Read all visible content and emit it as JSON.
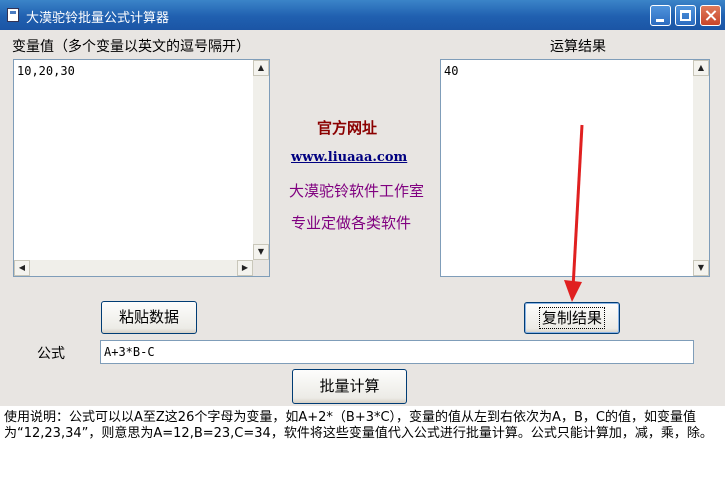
{
  "window": {
    "title": "大漠驼铃批量公式计算器"
  },
  "variables": {
    "label": "变量值（多个变量以英文的逗号隔开）",
    "value": "10,20,30"
  },
  "result": {
    "label": "运算结果",
    "value": "40"
  },
  "info": {
    "heading": "官方网址",
    "url": "www.liuaaa.com",
    "studio": "大漠驼铃软件工作室",
    "tagline": "专业定做各类软件"
  },
  "buttons": {
    "paste": "粘贴数据",
    "copy": "复制结果",
    "calculate": "批量计算"
  },
  "formula": {
    "label": "公式",
    "value": "A+3*B-C"
  },
  "help_text": "使用说明：公式可以以A至Z这26个字母为变量，如A+2*（B+3*C），变量的值从左到右依次为A，B，C的值，如变量值为“12,23,34”，则意思为A=12,B=23,C=34，软件将这些变量值代入公式进行批量计算。公式只能计算加，减，乘，除。",
  "colors": {
    "heading": "#8b0000",
    "url": "#000080",
    "studio": "#800080",
    "arrow": "#e02020"
  }
}
